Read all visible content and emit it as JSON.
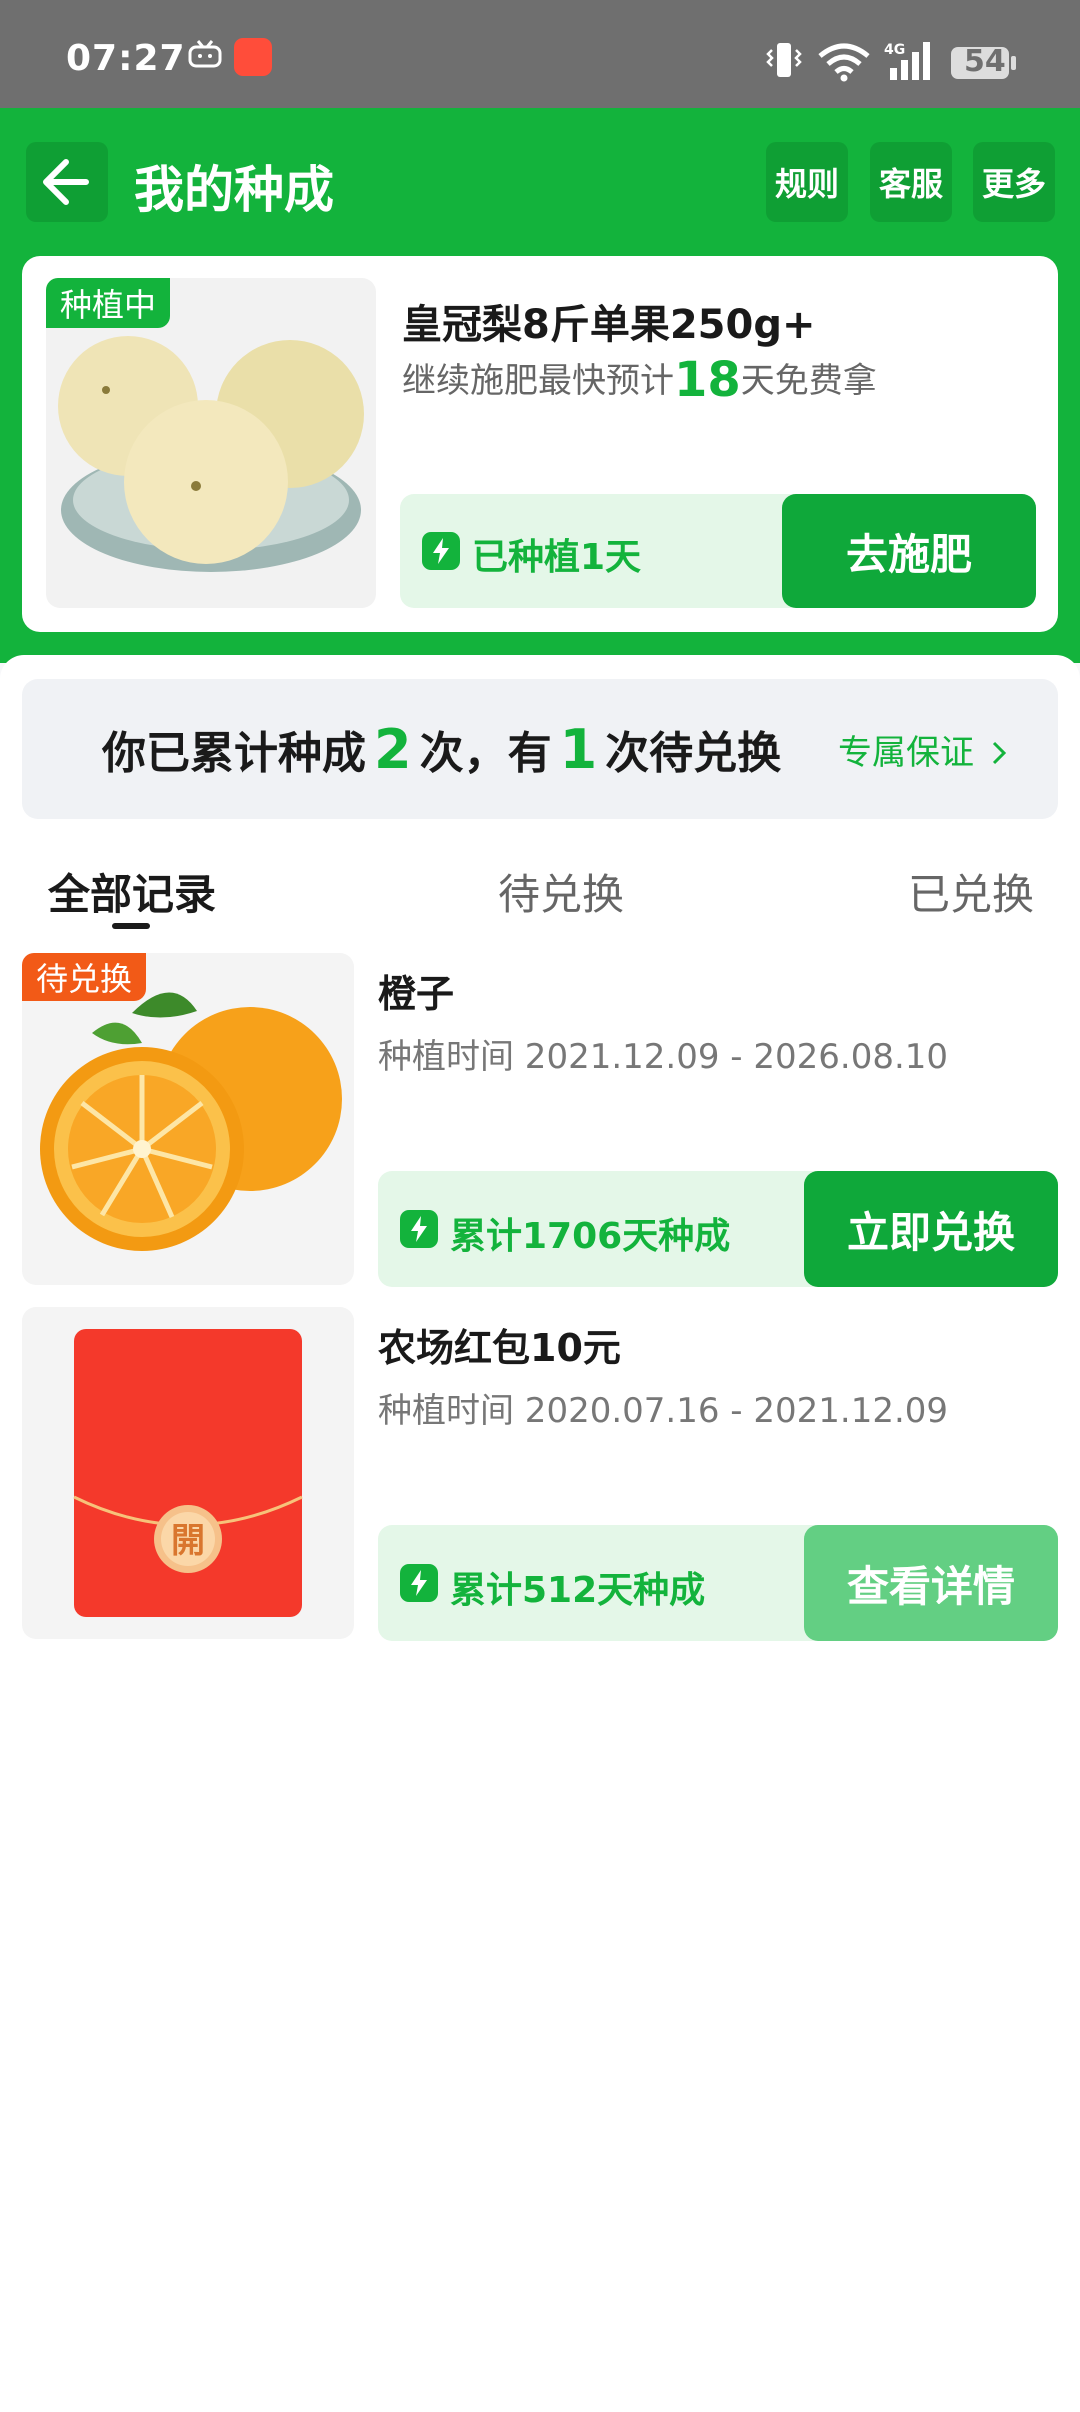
{
  "status_bar": {
    "time": "07:27",
    "battery": "54",
    "network": "4G",
    "icons": [
      "tv-icon",
      "app-badge-icon",
      "vibrate-icon",
      "wifi-icon",
      "signal-icon",
      "battery-icon"
    ]
  },
  "header": {
    "title": "我的种成",
    "buttons": {
      "rules": "规则",
      "service": "客服",
      "more": "更多"
    }
  },
  "current_crop": {
    "status_tag": "种植中",
    "name": "皇冠梨8斤单果250g+",
    "desc_prefix": "继续施肥最快预计",
    "desc_days": "18",
    "desc_suffix": "天免费拿",
    "progress": "已种植1天",
    "action": "去施肥"
  },
  "summary": {
    "part1": "你已累计种成",
    "count_done": "2",
    "part2": "次，有",
    "count_pending": "1",
    "part3": "次待兑换",
    "guarantee": "专属保证"
  },
  "tabs": {
    "all": "全部记录",
    "pending": "待兑换",
    "redeemed": "已兑换",
    "active": "all"
  },
  "records": [
    {
      "tag": "待兑换",
      "name": "橙子",
      "time": "种植时间 2021.12.09 - 2026.08.10",
      "progress": "累计1706天种成",
      "action": "立即兑换"
    },
    {
      "tag": "",
      "name": "农场红包10元",
      "time": "种植时间 2020.07.16 - 2021.12.09",
      "progress": "累计512天种成",
      "action": "查看详情",
      "envelope_char": "開"
    }
  ],
  "colors": {
    "brand_green": "#13b33c",
    "tag_orange": "#f25a17",
    "envelope_red": "#f4392b"
  }
}
